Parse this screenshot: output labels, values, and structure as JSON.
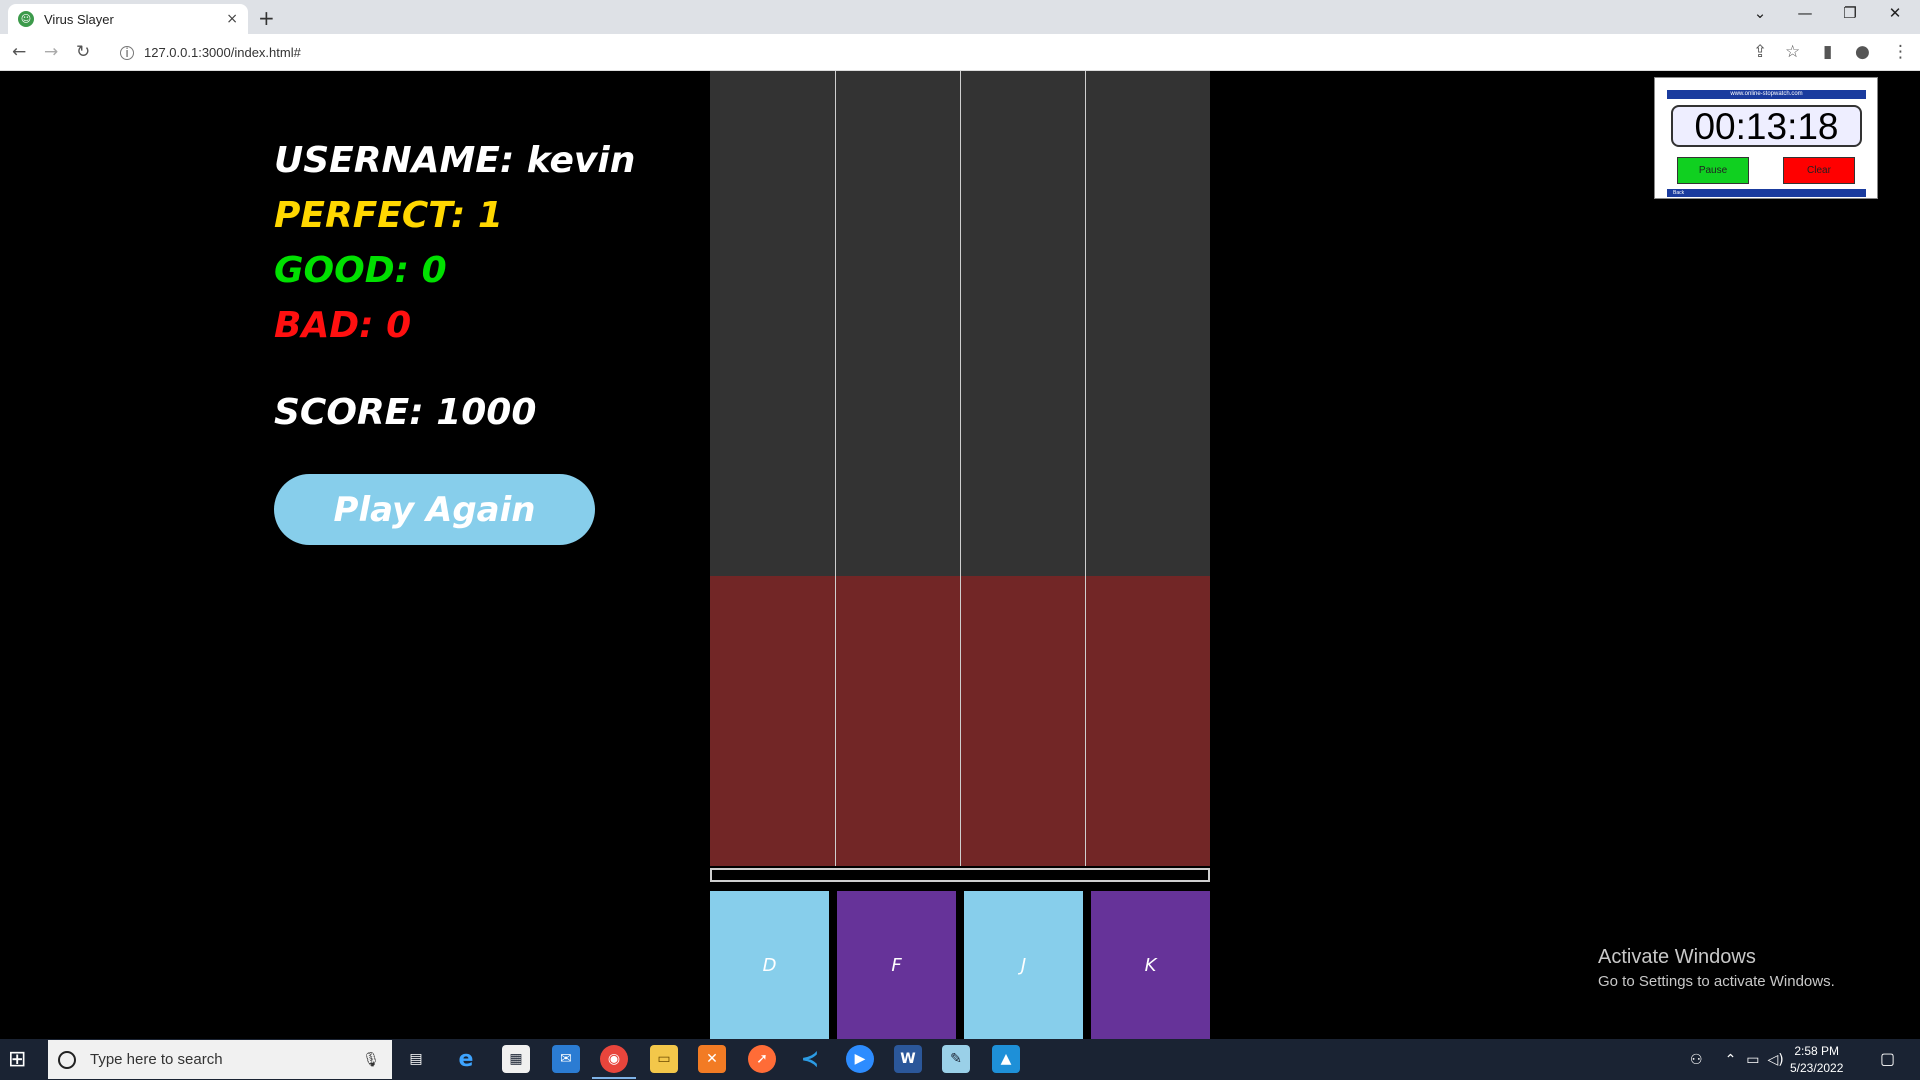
{
  "browser": {
    "tab_title": "Virus Slayer",
    "tab_close": "×",
    "new_tab": "+",
    "url": "127.0.0.1:3000/index.html#",
    "window_controls": {
      "minimize": "—",
      "restore": "❐",
      "close": "✕",
      "tab_search": "⌄"
    }
  },
  "game": {
    "username_label": "USERNAME: kevin",
    "perfect_label": "PERFECT: 1",
    "good_label": "GOOD: 0",
    "bad_label": "BAD: 0",
    "score_label": "SCORE: 1000",
    "play_again_label": "Play Again",
    "keys": [
      {
        "label": "D",
        "color": "#87ceeb"
      },
      {
        "label": "F",
        "color": "#663399"
      },
      {
        "label": "J",
        "color": "#87ceeb"
      },
      {
        "label": "K",
        "color": "#663399"
      }
    ],
    "colors": {
      "lane": "#333333",
      "hit_zone": "#722626",
      "perfect": "#ffd700",
      "good": "#00e000",
      "bad": "#ff1010"
    }
  },
  "stopwatch": {
    "site": "www.online-stopwatch.com",
    "time": "00:13:18",
    "pause_label": "Pause",
    "clear_label": "Clear",
    "back_label": "Back"
  },
  "watermark": {
    "line1": "Activate Windows",
    "line2": "Go to Settings to activate Windows."
  },
  "taskbar": {
    "search_placeholder": "Type here to search",
    "time": "2:58 PM",
    "date": "5/23/2022",
    "apps": [
      "task-view",
      "edge",
      "store",
      "mail",
      "chrome",
      "explorer",
      "xampp",
      "postman",
      "vscode",
      "zoom",
      "word",
      "notepad",
      "photos"
    ]
  }
}
